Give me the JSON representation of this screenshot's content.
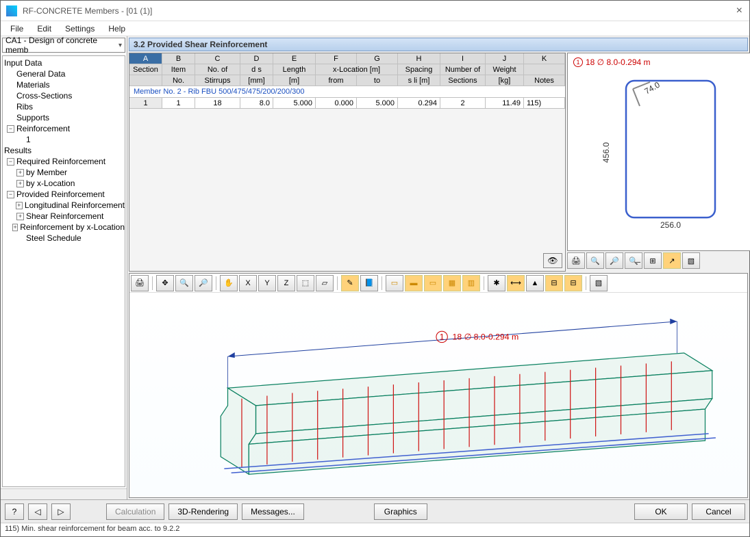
{
  "window": {
    "title": "RF-CONCRETE Members - [01 (1)]"
  },
  "menu": {
    "file": "File",
    "edit": "Edit",
    "settings": "Settings",
    "help": "Help"
  },
  "case_selector": "CA1 - Design of concrete memb",
  "tree": {
    "input_data": "Input Data",
    "general_data": "General Data",
    "materials": "Materials",
    "cross_sections": "Cross-Sections",
    "ribs": "Ribs",
    "supports": "Supports",
    "reinforcement": "Reinforcement",
    "reinf_1": "1",
    "results": "Results",
    "required": "Required Reinforcement",
    "by_member": "by Member",
    "by_xloc": "by x-Location",
    "provided": "Provided Reinforcement",
    "long_reinf": "Longitudinal Reinforcement",
    "shear_reinf": "Shear Reinforcement",
    "reinf_by_xloc": "Reinforcement by x-Location",
    "steel_sched": "Steel Schedule"
  },
  "section_title": "3.2  Provided Shear Reinforcement",
  "table": {
    "letters": [
      "A",
      "B",
      "C",
      "D",
      "E",
      "F",
      "G",
      "H",
      "I",
      "J",
      "K"
    ],
    "header1": [
      "Section",
      "Item",
      "No. of",
      "d s",
      "Length",
      "x-Location [m]",
      "",
      "Spacing",
      "Number of",
      "Weight",
      ""
    ],
    "header2": [
      "",
      "No.",
      "Stirrups",
      "[mm]",
      "[m]",
      "from",
      "to",
      "s li [m]",
      "Sections",
      "[kg]",
      "Notes"
    ],
    "member_row": "Member No. 2   -   Rib FBU 500/475/475/200/200/300",
    "row": [
      "1",
      "1",
      "18",
      "8.0",
      "5.000",
      "0.000",
      "5.000",
      "0.294",
      "2",
      "11.49",
      "115)"
    ]
  },
  "xsection": {
    "label_num": "1",
    "label_txt": "18 ∅ 8.0-0.294 m",
    "dim_h": "456.0",
    "dim_w": "256.0",
    "dim_diag": "74.0"
  },
  "render_label": {
    "num": "1",
    "txt": "18 ∅ 8.0-0.294 m"
  },
  "buttons": {
    "calculation": "Calculation",
    "rendering": "3D-Rendering",
    "messages": "Messages...",
    "graphics": "Graphics",
    "ok": "OK",
    "cancel": "Cancel"
  },
  "status": "115) Min. shear reinforcement for beam acc. to 9.2.2"
}
